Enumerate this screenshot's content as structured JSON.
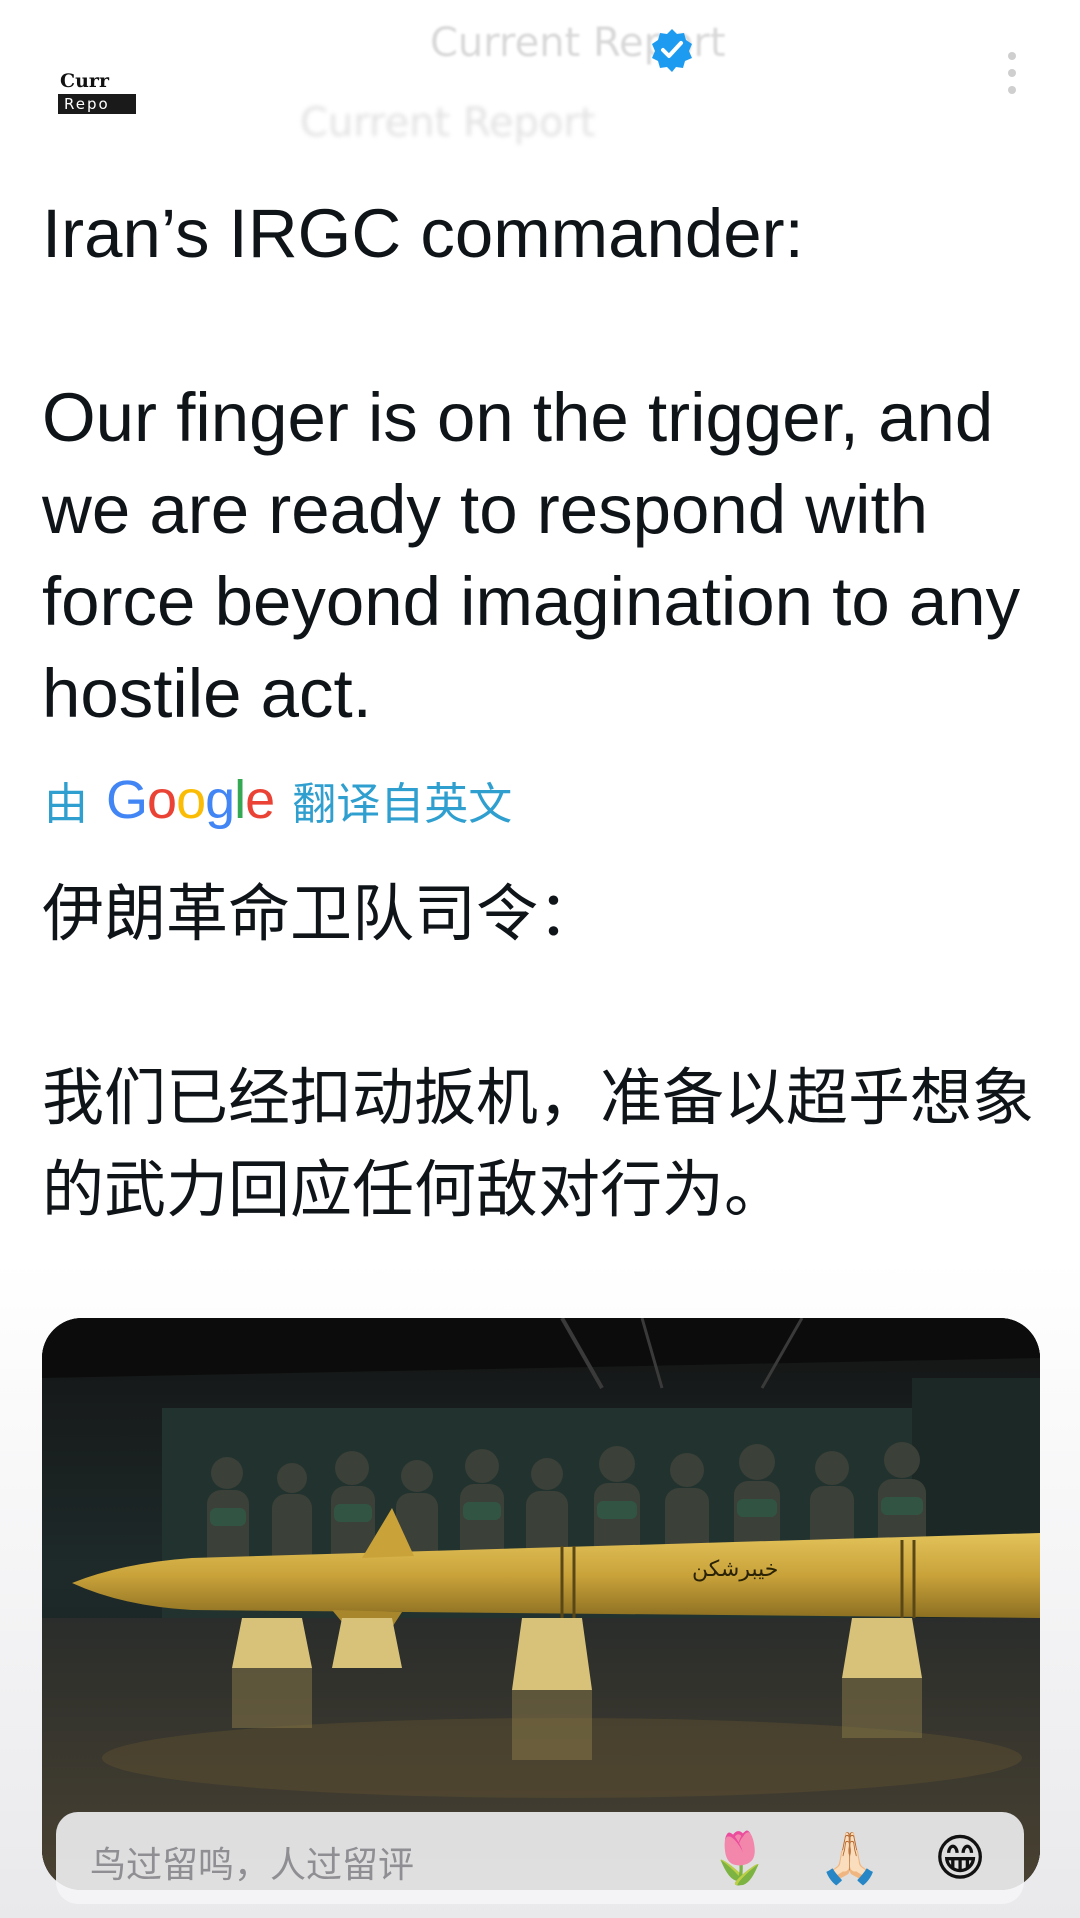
{
  "header": {
    "account_name": "Current Report",
    "account_handle": "Current Report",
    "logo_top": "Curr",
    "logo_bottom": "Repo",
    "verified_icon": "verified-badge-icon",
    "more_icon": "more-vertical-icon"
  },
  "post": {
    "text_en": "Iran’s IRGC commander:\n\nOur finger is on the trigger, and we are ready to respond with force beyond imagination to any hostile act.",
    "translate_prefix": "由",
    "translate_brand": "Google",
    "translate_suffix": "翻译自英文",
    "text_zh": "伊朗革命卫队司令：\n\n我们已经扣动扳机，准备以超乎想象的武力回应任何敌对行为。",
    "media": {
      "description_icon": "missile-image",
      "missile_inscription": "خیبرشکن"
    }
  },
  "comment_bar": {
    "placeholder": "鸟过留鸣，人过留评",
    "emoji_1": "🌷",
    "emoji_2": "🙏🏻",
    "emoji_3": "😁"
  }
}
